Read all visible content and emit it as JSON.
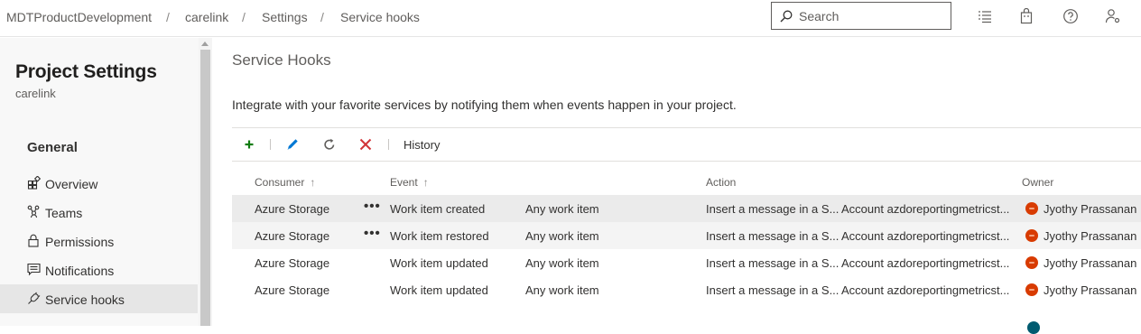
{
  "breadcrumb": [
    "MDTProductDevelopment",
    "carelink",
    "Settings",
    "Service hooks"
  ],
  "search": {
    "placeholder": "Search"
  },
  "topbar_icons": [
    "list-icon",
    "shopping-bag-icon",
    "help-icon",
    "user-settings-icon"
  ],
  "sidebar": {
    "title": "Project Settings",
    "subtitle": "carelink",
    "section": "General",
    "items": [
      {
        "label": "Overview",
        "icon": "overview-icon",
        "selected": false
      },
      {
        "label": "Teams",
        "icon": "teams-icon",
        "selected": false
      },
      {
        "label": "Permissions",
        "icon": "lock-icon",
        "selected": false
      },
      {
        "label": "Notifications",
        "icon": "notifications-icon",
        "selected": false
      },
      {
        "label": "Service hooks",
        "icon": "service-hooks-icon",
        "selected": true
      }
    ]
  },
  "main": {
    "title": "Service Hooks",
    "description": "Integrate with your favorite services by notifying them when events happen in your project.",
    "toolbar": {
      "icons": [
        "add-icon",
        "edit-icon",
        "refresh-icon",
        "delete-icon"
      ],
      "history_label": "History"
    },
    "table": {
      "headers": {
        "consumer": "Consumer",
        "event": "Event",
        "action": "Action",
        "owner": "Owner"
      },
      "sort_arrow": "↑",
      "more_glyph": "•••",
      "rows": [
        {
          "consumer": "Azure Storage",
          "event": "Work item created",
          "filter": "Any work item",
          "action": "Insert a message in a S...",
          "detail": "Account azdoreportingmetricst...",
          "owner": "Jyothy Prassanan"
        },
        {
          "consumer": "Azure Storage",
          "event": "Work item restored",
          "filter": "Any work item",
          "action": "Insert a message in a S...",
          "detail": "Account azdoreportingmetricst...",
          "owner": "Jyothy Prassanan"
        },
        {
          "consumer": "Azure Storage",
          "event": "Work item updated",
          "filter": "Any work item",
          "action": "Insert a message in a S...",
          "detail": "Account azdoreportingmetricst...",
          "owner": "Jyothy Prassanan"
        },
        {
          "consumer": "Azure Storage",
          "event": "Work item updated",
          "filter": "Any work item",
          "action": "Insert a message in a S...",
          "detail": "Account azdoreportingmetricst...",
          "owner": "Jyothy Prassanan"
        }
      ]
    }
  },
  "colors": {
    "accent": "#0078d4",
    "add": "#107c10",
    "delete": "#d13438",
    "avatar": "#d83b01",
    "selected_nav": "#e6e6e6"
  }
}
